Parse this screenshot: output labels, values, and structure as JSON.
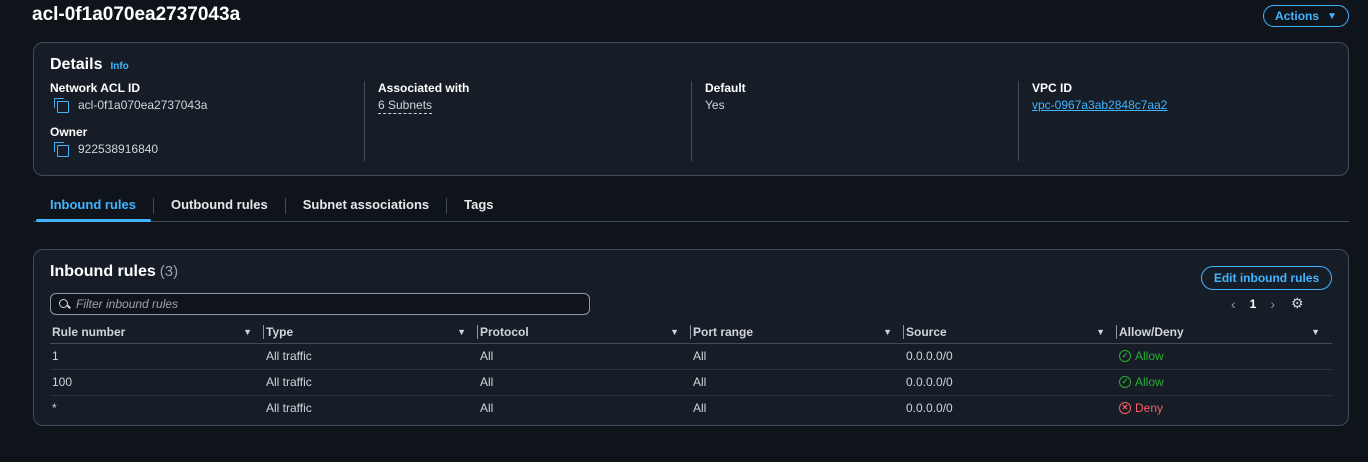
{
  "page": {
    "title": "acl-0f1a070ea2737043a",
    "actions_label": "Actions"
  },
  "details": {
    "heading": "Details",
    "info_label": "Info",
    "network_acl_id": {
      "label": "Network ACL ID",
      "value": "acl-0f1a070ea2737043a"
    },
    "owner": {
      "label": "Owner",
      "value": "922538916840"
    },
    "associated_with": {
      "label": "Associated with",
      "value": "6 Subnets"
    },
    "default": {
      "label": "Default",
      "value": "Yes"
    },
    "vpc_id": {
      "label": "VPC ID",
      "value": "vpc-0967a3ab2848c7aa2"
    }
  },
  "tabs": [
    "Inbound rules",
    "Outbound rules",
    "Subnet associations",
    "Tags"
  ],
  "active_tab": "Inbound rules",
  "inbound": {
    "heading": "Inbound rules",
    "count": "(3)",
    "edit_label": "Edit inbound rules",
    "filter_placeholder": "Filter inbound rules",
    "page_number": "1",
    "columns": [
      "Rule number",
      "Type",
      "Protocol",
      "Port range",
      "Source",
      "Allow/Deny"
    ],
    "rows": [
      {
        "rule": "1",
        "type": "All traffic",
        "protocol": "All",
        "port": "All",
        "source": "0.0.0.0/0",
        "action": "Allow"
      },
      {
        "rule": "100",
        "type": "All traffic",
        "protocol": "All",
        "port": "All",
        "source": "0.0.0.0/0",
        "action": "Allow"
      },
      {
        "rule": "*",
        "type": "All traffic",
        "protocol": "All",
        "port": "All",
        "source": "0.0.0.0/0",
        "action": "Deny"
      }
    ]
  },
  "colors": {
    "accent": "#42b4ff",
    "allow": "#29ad32",
    "deny": "#ff5d64",
    "background": "#0f141a",
    "container": "#161d26"
  },
  "icons": [
    "copy-icon",
    "search-icon",
    "chevron-left-icon",
    "chevron-right-icon",
    "gear-icon",
    "caret-down-icon",
    "check-circle-icon",
    "x-circle-icon"
  ]
}
